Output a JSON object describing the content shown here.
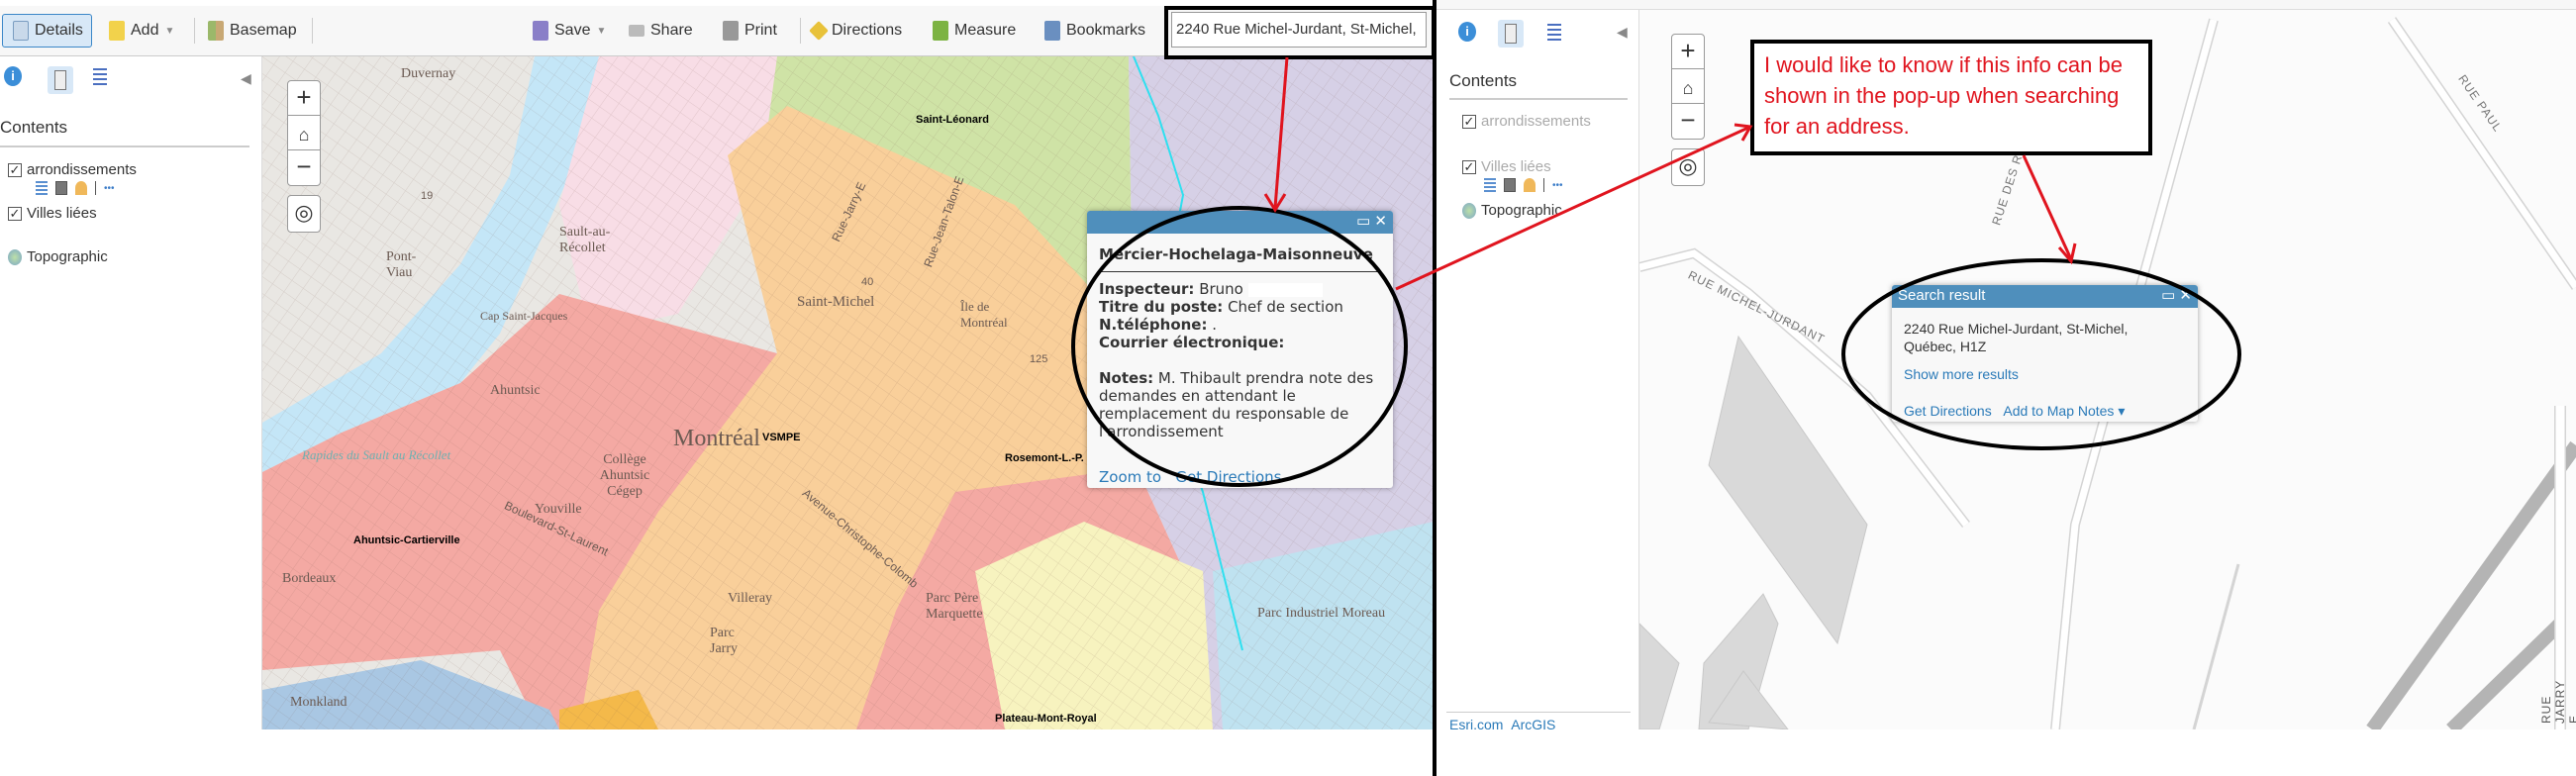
{
  "toolbar": {
    "details": "Details",
    "add": "Add",
    "basemap": "Basemap",
    "save": "Save",
    "share": "Share",
    "print": "Print",
    "directions": "Directions",
    "measure": "Measure",
    "bookmarks": "Bookmarks",
    "search_value": "2240 Rue Michel-Jurdant, St-Michel,"
  },
  "left_panel": {
    "contents_title": "Contents",
    "layers": [
      {
        "label": "arrondissements",
        "checked": true
      },
      {
        "label": "Villes liées",
        "checked": true
      }
    ],
    "basemap_label": "Topographic",
    "more_icon": "•••"
  },
  "map": {
    "labels": [
      "Duvernay",
      "Saint-Léonard",
      "Saint-Michel",
      "Montréal",
      "VSMPE",
      "Ahuntsic-Cartierville",
      "Rosemont-L.-P.",
      "Plateau-Mont-Royal",
      "Ahuntsic",
      "Youville",
      "Villeray",
      "Bordeaux",
      "Monkland",
      "Sault-au-Récollet",
      "Pont-Viau",
      "Parc Jarry",
      "Collège Ahuntsic Cégep",
      "Parc Père Marquette",
      "Parc Industriel Moreau",
      "Boulevard-St-Laurent",
      "Avenue-Christophe-Colomb",
      "Rue-Jarry-E",
      "Rue-Jean-Talon-E",
      "Cap Saint-Jacques",
      "Île de Montréal",
      "Rapides du Sault au Récollet",
      "19",
      "125",
      "40"
    ],
    "zoom_in": "+",
    "zoom_out": "−"
  },
  "popup": {
    "title": "Mercier-Hochelaga-Maisonneuve",
    "fields": [
      {
        "label": "Inspecteur:",
        "value": "Bruno"
      },
      {
        "label": "Titre du poste:",
        "value": "Chef de section"
      },
      {
        "label": "N.téléphone:",
        "value": "."
      },
      {
        "label": "Courrier électronique:",
        "value": ""
      }
    ],
    "notes_label": "Notes:",
    "notes_value": "M. Thibault prendra note des demandes en attendant le remplacement du responsable de l'arrondissement",
    "zoom_to": "Zoom to",
    "get_directions": "Get Directions"
  },
  "right_panel": {
    "contents_title": "Contents",
    "layers": [
      {
        "label": "arrondissements"
      },
      {
        "label": "Villes liées"
      }
    ],
    "basemap_label": "Topographic",
    "footer_links": [
      "Esri.com",
      "ArcGIS"
    ]
  },
  "right_map": {
    "streets": [
      "RUE MICHEL-JURDANT",
      "RUE DES REGRATTIERS",
      "RUE PAUL",
      "RUE JARRY E"
    ]
  },
  "search_result": {
    "title": "Search result",
    "address_line1": "2240 Rue Michel-Jurdant, St-Michel,",
    "address_line2": "Québec, H1Z",
    "show_more": "Show more results",
    "get_directions": "Get Directions",
    "add_to_notes": "Add to Map Notes ▾"
  },
  "annotation": {
    "text": "I would like to know if this info can be shown in the pop-up when searching for an address."
  },
  "colors": {
    "popup_header": "#4f8fbc",
    "annotation_red": "#e0141e",
    "link": "#2a7ab8"
  }
}
